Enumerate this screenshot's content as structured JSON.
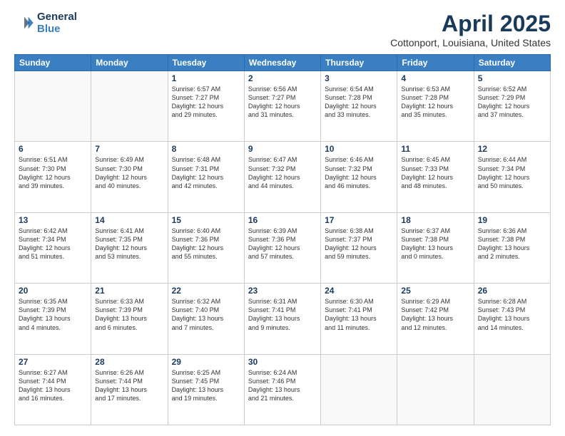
{
  "header": {
    "logo_line1": "General",
    "logo_line2": "Blue",
    "month": "April 2025",
    "location": "Cottonport, Louisiana, United States"
  },
  "weekdays": [
    "Sunday",
    "Monday",
    "Tuesday",
    "Wednesday",
    "Thursday",
    "Friday",
    "Saturday"
  ],
  "weeks": [
    [
      {
        "day": "",
        "info": ""
      },
      {
        "day": "",
        "info": ""
      },
      {
        "day": "1",
        "info": "Sunrise: 6:57 AM\nSunset: 7:27 PM\nDaylight: 12 hours\nand 29 minutes."
      },
      {
        "day": "2",
        "info": "Sunrise: 6:56 AM\nSunset: 7:27 PM\nDaylight: 12 hours\nand 31 minutes."
      },
      {
        "day": "3",
        "info": "Sunrise: 6:54 AM\nSunset: 7:28 PM\nDaylight: 12 hours\nand 33 minutes."
      },
      {
        "day": "4",
        "info": "Sunrise: 6:53 AM\nSunset: 7:28 PM\nDaylight: 12 hours\nand 35 minutes."
      },
      {
        "day": "5",
        "info": "Sunrise: 6:52 AM\nSunset: 7:29 PM\nDaylight: 12 hours\nand 37 minutes."
      }
    ],
    [
      {
        "day": "6",
        "info": "Sunrise: 6:51 AM\nSunset: 7:30 PM\nDaylight: 12 hours\nand 39 minutes."
      },
      {
        "day": "7",
        "info": "Sunrise: 6:49 AM\nSunset: 7:30 PM\nDaylight: 12 hours\nand 40 minutes."
      },
      {
        "day": "8",
        "info": "Sunrise: 6:48 AM\nSunset: 7:31 PM\nDaylight: 12 hours\nand 42 minutes."
      },
      {
        "day": "9",
        "info": "Sunrise: 6:47 AM\nSunset: 7:32 PM\nDaylight: 12 hours\nand 44 minutes."
      },
      {
        "day": "10",
        "info": "Sunrise: 6:46 AM\nSunset: 7:32 PM\nDaylight: 12 hours\nand 46 minutes."
      },
      {
        "day": "11",
        "info": "Sunrise: 6:45 AM\nSunset: 7:33 PM\nDaylight: 12 hours\nand 48 minutes."
      },
      {
        "day": "12",
        "info": "Sunrise: 6:44 AM\nSunset: 7:34 PM\nDaylight: 12 hours\nand 50 minutes."
      }
    ],
    [
      {
        "day": "13",
        "info": "Sunrise: 6:42 AM\nSunset: 7:34 PM\nDaylight: 12 hours\nand 51 minutes."
      },
      {
        "day": "14",
        "info": "Sunrise: 6:41 AM\nSunset: 7:35 PM\nDaylight: 12 hours\nand 53 minutes."
      },
      {
        "day": "15",
        "info": "Sunrise: 6:40 AM\nSunset: 7:36 PM\nDaylight: 12 hours\nand 55 minutes."
      },
      {
        "day": "16",
        "info": "Sunrise: 6:39 AM\nSunset: 7:36 PM\nDaylight: 12 hours\nand 57 minutes."
      },
      {
        "day": "17",
        "info": "Sunrise: 6:38 AM\nSunset: 7:37 PM\nDaylight: 12 hours\nand 59 minutes."
      },
      {
        "day": "18",
        "info": "Sunrise: 6:37 AM\nSunset: 7:38 PM\nDaylight: 13 hours\nand 0 minutes."
      },
      {
        "day": "19",
        "info": "Sunrise: 6:36 AM\nSunset: 7:38 PM\nDaylight: 13 hours\nand 2 minutes."
      }
    ],
    [
      {
        "day": "20",
        "info": "Sunrise: 6:35 AM\nSunset: 7:39 PM\nDaylight: 13 hours\nand 4 minutes."
      },
      {
        "day": "21",
        "info": "Sunrise: 6:33 AM\nSunset: 7:39 PM\nDaylight: 13 hours\nand 6 minutes."
      },
      {
        "day": "22",
        "info": "Sunrise: 6:32 AM\nSunset: 7:40 PM\nDaylight: 13 hours\nand 7 minutes."
      },
      {
        "day": "23",
        "info": "Sunrise: 6:31 AM\nSunset: 7:41 PM\nDaylight: 13 hours\nand 9 minutes."
      },
      {
        "day": "24",
        "info": "Sunrise: 6:30 AM\nSunset: 7:41 PM\nDaylight: 13 hours\nand 11 minutes."
      },
      {
        "day": "25",
        "info": "Sunrise: 6:29 AM\nSunset: 7:42 PM\nDaylight: 13 hours\nand 12 minutes."
      },
      {
        "day": "26",
        "info": "Sunrise: 6:28 AM\nSunset: 7:43 PM\nDaylight: 13 hours\nand 14 minutes."
      }
    ],
    [
      {
        "day": "27",
        "info": "Sunrise: 6:27 AM\nSunset: 7:44 PM\nDaylight: 13 hours\nand 16 minutes."
      },
      {
        "day": "28",
        "info": "Sunrise: 6:26 AM\nSunset: 7:44 PM\nDaylight: 13 hours\nand 17 minutes."
      },
      {
        "day": "29",
        "info": "Sunrise: 6:25 AM\nSunset: 7:45 PM\nDaylight: 13 hours\nand 19 minutes."
      },
      {
        "day": "30",
        "info": "Sunrise: 6:24 AM\nSunset: 7:46 PM\nDaylight: 13 hours\nand 21 minutes."
      },
      {
        "day": "",
        "info": ""
      },
      {
        "day": "",
        "info": ""
      },
      {
        "day": "",
        "info": ""
      }
    ]
  ]
}
